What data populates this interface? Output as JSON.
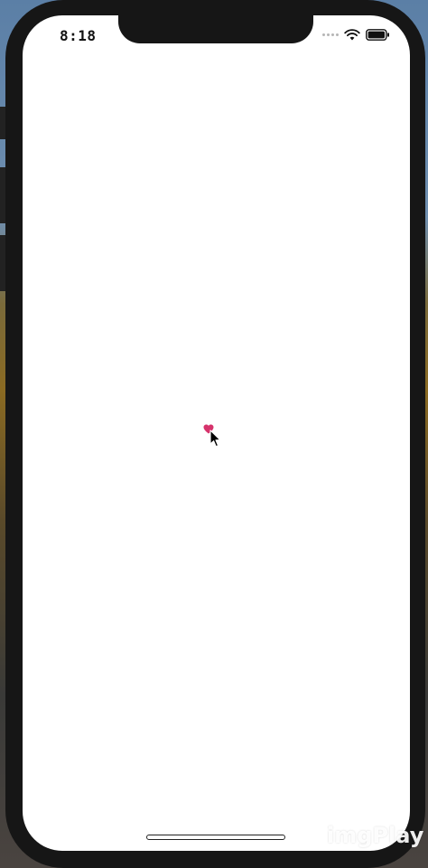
{
  "status_bar": {
    "time": "8:18",
    "icons": [
      "cellular-signal-icon",
      "wifi-icon",
      "battery-icon"
    ]
  },
  "content": {
    "icon": "heart-icon",
    "icon_color": "#d6336c"
  },
  "watermark": {
    "text": "imgPlay"
  },
  "colors": {
    "screen_background": "#ffffff",
    "bezel": "#161616"
  }
}
